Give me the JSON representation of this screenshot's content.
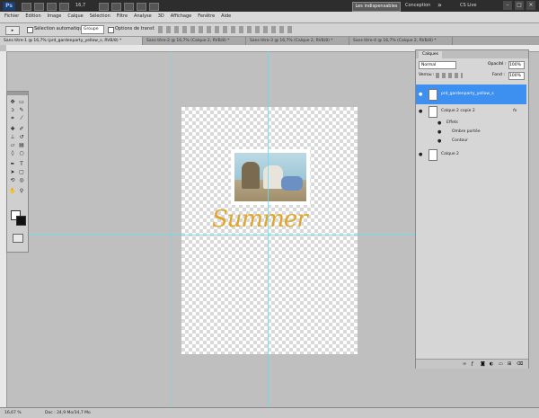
{
  "app": {
    "logo": "Ps"
  },
  "menu": [
    "Fichier",
    "Edition",
    "Image",
    "Calque",
    "Sélection",
    "Filtre",
    "Analyse",
    "3D",
    "Affichage",
    "Fenêtre",
    "Aide"
  ],
  "topbar": {
    "zoom": "16,7",
    "workspace_active": "Les indispensables",
    "workspace_other": "Conception",
    "more": "»",
    "cslive": "CS Live"
  },
  "options": {
    "auto_select_label": "Sélection automatique",
    "auto_select_value": "Groupe",
    "transform_label": "Options de transf."
  },
  "tabs": [
    "Sans titre-1 @ 16,7% (prd_gardenparty_yellow_s, RVB/8) *",
    "Sans titre-2 @ 16,7% (Calque 2, RVB/8) *",
    "Sans titre-3 @ 16,7% (Calque 2, RVB/8) *",
    "Sans titre-4 @ 16,7% (Calque 2, RVB/8) *"
  ],
  "canvas": {
    "title_text": "Summer"
  },
  "layers_panel": {
    "tab_label": "Calques",
    "blend_mode": "Normal",
    "opacity_label": "Opacité :",
    "opacity_value": "100%",
    "lock_label": "Verrou :",
    "fill_label": "Fond :",
    "fill_value": "100%",
    "layers": [
      {
        "name": "prd_gardenparty_yellow_s",
        "selected": true
      },
      {
        "name": "Calque 2 copie 2",
        "fx": "fx"
      },
      {
        "name": "Effets"
      },
      {
        "name": "Ombre portée"
      },
      {
        "name": "Contour"
      },
      {
        "name": "Calque 2"
      }
    ],
    "footer_icons": [
      "link-icon",
      "fx-icon",
      "mask-icon",
      "adjustment-icon",
      "group-icon",
      "new-layer-icon",
      "trash-icon"
    ]
  },
  "status": {
    "zoom": "16,67 %",
    "doc": "Doc : 24,9 Mo/34,7 Mo"
  },
  "colors": {
    "selection": "#3d8ff0",
    "summer_text": "#e0a52a",
    "guides": "#5fe0f0"
  }
}
